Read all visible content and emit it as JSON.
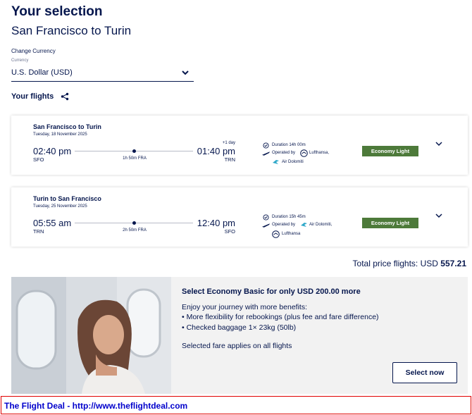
{
  "header": {
    "title": "Your selection",
    "subtitle": "San Francisco to Turin"
  },
  "currency": {
    "label": "Change Currency",
    "field_label": "Currency",
    "selected": "U.S. Dollar (USD)"
  },
  "flights_section": {
    "title": "Your flights"
  },
  "flights": [
    {
      "route": "San Francisco to Turin",
      "date": "Tuesday, 18 November 2025",
      "dep_time": "02:40 pm",
      "dep_code": "SFO",
      "stop": "1h 50m FRA",
      "plus_day": "+1 day",
      "arr_time": "01:40 pm",
      "arr_code": "TRN",
      "duration": "Duration 14h 00m",
      "operated_by": "Operated by",
      "airline1": "Lufthansa,",
      "airline2": "Air Dolomiti",
      "fare": "Economy Light"
    },
    {
      "route": "Turin to San Francisco",
      "date": "Tuesday, 25 November 2025",
      "dep_time": "05:55 am",
      "dep_code": "TRN",
      "stop": "2h 50m FRA",
      "plus_day": "",
      "arr_time": "12:40 pm",
      "arr_code": "SFO",
      "duration": "Duration 15h 45m",
      "operated_by": "Operated by",
      "airline1": "Air Dolomiti,",
      "airline2": "Lufthansa",
      "fare": "Economy Light"
    }
  ],
  "total": {
    "label": "Total price flights:",
    "currency": "USD",
    "amount": "557.21"
  },
  "promo": {
    "title": "Select Economy Basic for only USD 200.00 more",
    "line1": "Enjoy your journey with more benefits:",
    "line2": "• More flexibility for rebookings (plus fee and fare difference)",
    "line3": "• Checked baggage 1× 23kg (50lb)",
    "line4": "Selected fare applies on all flights",
    "button": "Select now"
  },
  "footer": {
    "text": "The Flight Deal - http://www.theflightdeal.com"
  },
  "colors": {
    "navy": "#05164d",
    "fare_green": "#4d7a3a",
    "footer_red": "#e00000",
    "footer_link": "#0000cc"
  }
}
